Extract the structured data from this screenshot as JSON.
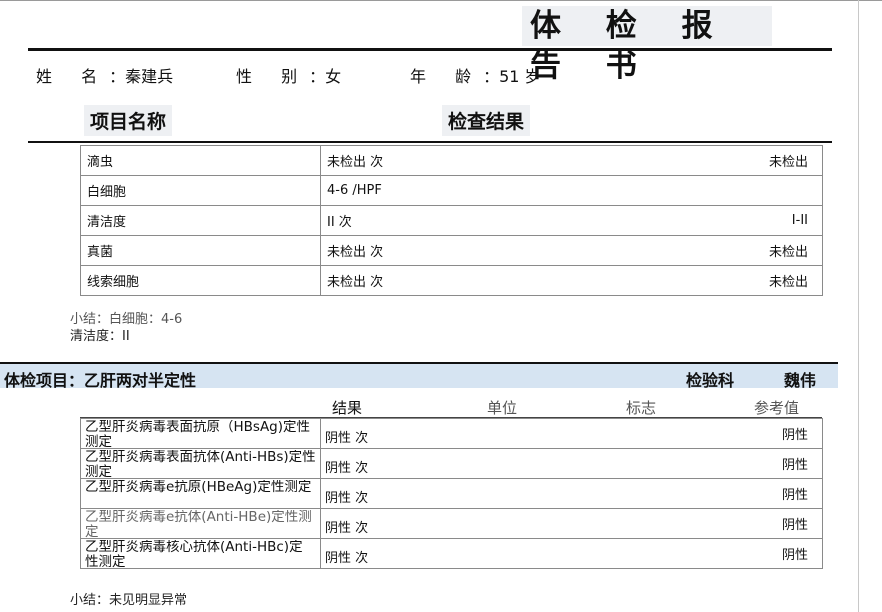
{
  "report": {
    "title": "体 检 报 告 书"
  },
  "patient": {
    "name_label": "姓 名",
    "name_value": "：秦建兵",
    "gender_label": "性 别",
    "gender_value": "：女",
    "age_label": "年 龄",
    "age_value": "：51 岁"
  },
  "columns": {
    "item": "项目名称",
    "result": "检查结果"
  },
  "section1": {
    "rows": [
      {
        "name": "滴虫",
        "value": "未检出  次",
        "reference": "未检出"
      },
      {
        "name": "白细胞",
        "value": "4-6  /HPF",
        "reference": ""
      },
      {
        "name": "清洁度",
        "value": "II  次",
        "reference": "I-II"
      },
      {
        "name": "真菌",
        "value": "未检出  次",
        "reference": "未检出"
      },
      {
        "name": "线索细胞",
        "value": "未检出  次",
        "reference": "未检出"
      }
    ],
    "summary_line1": "小结：白细胞：4-6",
    "summary_line2": "清洁度：II"
  },
  "section2": {
    "title": "体检项目：乙肝两对半定性",
    "department": "检验科",
    "doctor": "魏伟",
    "headers": {
      "result": "结果",
      "unit": "单位",
      "flag": "标志",
      "reference": "参考值"
    },
    "rows": [
      {
        "name": "乙型肝炎病毒表面抗原（HBsAg)定性测定",
        "value": "阴性  次",
        "reference": "阴性"
      },
      {
        "name": "乙型肝炎病毒表面抗体(Anti-HBs)定性测定",
        "value": "阴性  次",
        "reference": "阴性"
      },
      {
        "name": "乙型肝炎病毒e抗原(HBeAg)定性测定",
        "value": "阴性  次",
        "reference": "阴性"
      },
      {
        "name": "乙型肝炎病毒e抗体(Anti-HBe)定性测定",
        "value": "阴性  次",
        "reference": "阴性"
      },
      {
        "name": "乙型肝炎病毒核心抗体(Anti-HBc)定性测定",
        "value": "阴性  次",
        "reference": "阴性"
      }
    ],
    "summary": "小结：未见明显异常"
  }
}
